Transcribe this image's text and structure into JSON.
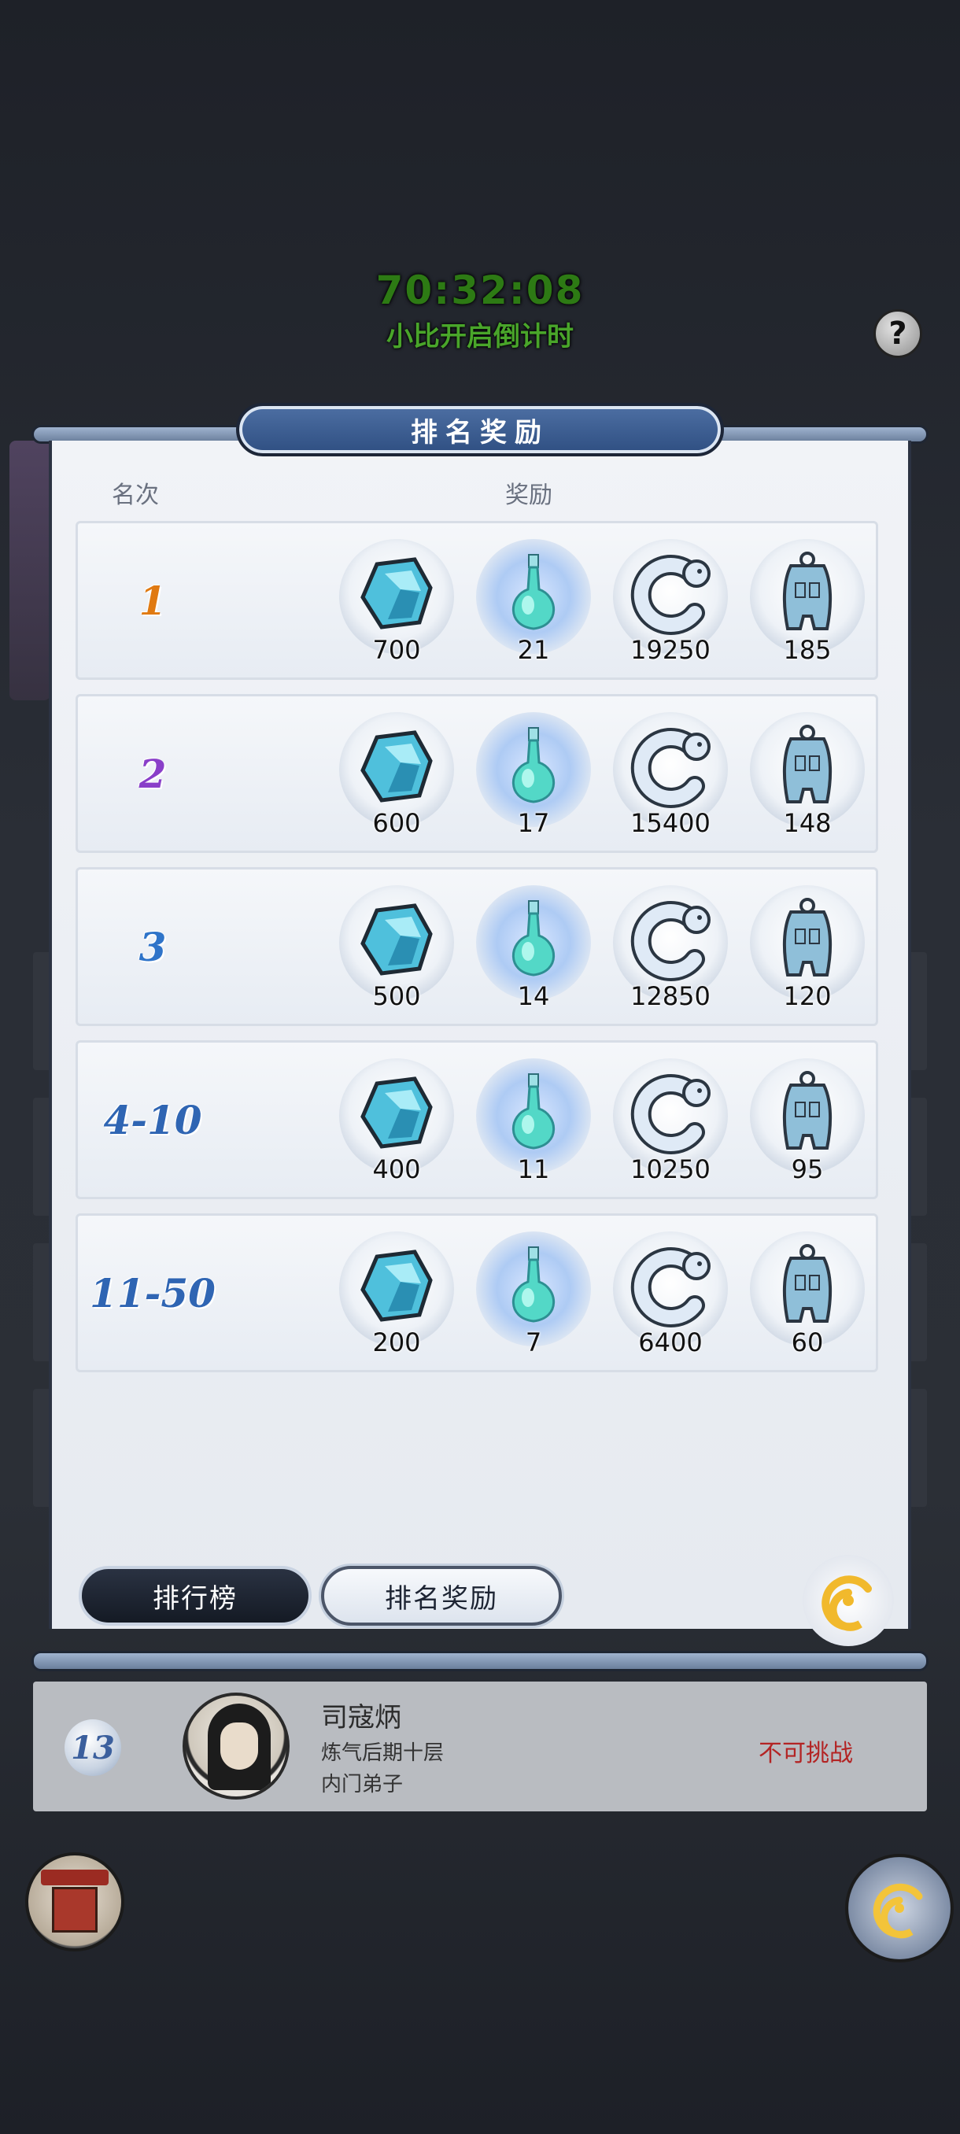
{
  "countdown": {
    "time": "70:32:08",
    "label": "小比开启倒计时"
  },
  "help": {
    "symbol": "?"
  },
  "modal": {
    "title": "排名奖励",
    "header_rank": "名次",
    "header_reward": "奖励",
    "rows": [
      {
        "rank": "1",
        "color": "#e07a12",
        "spirit_stone": "700",
        "elixir": "21",
        "jade_dragon": "19250",
        "token": "185"
      },
      {
        "rank": "2",
        "color": "#8a3fc9",
        "spirit_stone": "600",
        "elixir": "17",
        "jade_dragon": "15400",
        "token": "148"
      },
      {
        "rank": "3",
        "color": "#2f74c9",
        "spirit_stone": "500",
        "elixir": "14",
        "jade_dragon": "12850",
        "token": "120"
      },
      {
        "rank": "4-10",
        "color": "#2f65b3",
        "spirit_stone": "400",
        "elixir": "11",
        "jade_dragon": "10250",
        "token": "95"
      },
      {
        "rank": "11-50",
        "color": "#2f65b3",
        "spirit_stone": "200",
        "elixir": "7",
        "jade_dragon": "6400",
        "token": "60"
      }
    ],
    "tabs": {
      "leaderboard": "排行榜",
      "rewards": "排名奖励"
    }
  },
  "player": {
    "rank": "13",
    "name": "司寇炳",
    "realm": "炼气后期十层",
    "role": "内门弟子",
    "status": "不可挑战"
  },
  "icons": {
    "spirit_stone": "blue-crystal-icon",
    "elixir": "elixir-bottle-icon",
    "jade_dragon": "jade-dragon-icon",
    "token": "silver-token-icon"
  }
}
